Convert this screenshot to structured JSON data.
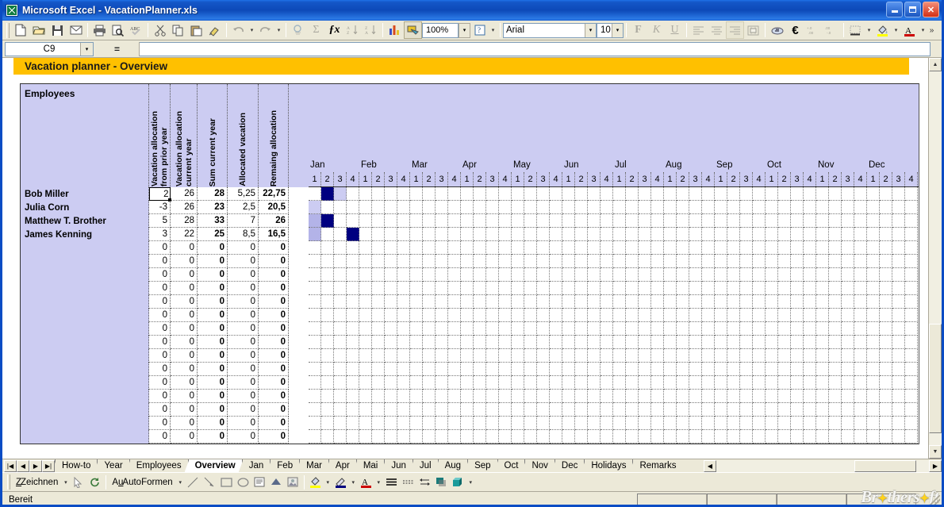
{
  "window": {
    "title": "Microsoft Excel - VacationPlanner.xls",
    "app_icon": "excel-icon",
    "minimize": "–",
    "maximize": "□",
    "close": "✕"
  },
  "toolbar": {
    "zoom_value": "100%",
    "font_name": "Arial",
    "font_size": "10",
    "bold_label": "F",
    "italic_label": "K",
    "underline_label": "U",
    "buttons": [
      "new-icon",
      "open-icon",
      "save-icon",
      "email-icon",
      "print-icon",
      "print-preview-icon",
      "spelling-icon",
      "cut-icon",
      "copy-icon",
      "paste-icon",
      "format-painter-icon",
      "undo-icon",
      "redo-icon",
      "hyperlink-icon",
      "autosum-icon",
      "function-icon",
      "sort-asc-icon",
      "sort-desc-icon",
      "chart-icon",
      "drawing-icon",
      "help-icon"
    ]
  },
  "formula_bar": {
    "name_box": "C9",
    "equals": "=",
    "content": ""
  },
  "banner": {
    "title": "Vacation planner - Overview"
  },
  "table": {
    "employees_header": "Employees",
    "columns": [
      "Vacation allocation\nfrom prior year",
      "Vacation allocation\ncurrent year",
      "Sum current year",
      "Allocated vacation",
      "Remaing allocation"
    ],
    "rows": [
      {
        "name": "Bob Miller",
        "prior": "2",
        "current": "26",
        "sum": "28",
        "allocated": "5,25",
        "remaining": "22,75"
      },
      {
        "name": "Julia Corn",
        "prior": "-3",
        "current": "26",
        "sum": "23",
        "allocated": "2,5",
        "remaining": "20,5"
      },
      {
        "name": "Matthew T. Brother",
        "prior": "5",
        "current": "28",
        "sum": "33",
        "allocated": "7",
        "remaining": "26"
      },
      {
        "name": "James Kenning",
        "prior": "3",
        "current": "22",
        "sum": "25",
        "allocated": "8,5",
        "remaining": "16,5"
      },
      {
        "name": "",
        "prior": "0",
        "current": "0",
        "sum": "0",
        "allocated": "0",
        "remaining": "0"
      },
      {
        "name": "",
        "prior": "0",
        "current": "0",
        "sum": "0",
        "allocated": "0",
        "remaining": "0"
      },
      {
        "name": "",
        "prior": "0",
        "current": "0",
        "sum": "0",
        "allocated": "0",
        "remaining": "0"
      },
      {
        "name": "",
        "prior": "0",
        "current": "0",
        "sum": "0",
        "allocated": "0",
        "remaining": "0"
      },
      {
        "name": "",
        "prior": "0",
        "current": "0",
        "sum": "0",
        "allocated": "0",
        "remaining": "0"
      },
      {
        "name": "",
        "prior": "0",
        "current": "0",
        "sum": "0",
        "allocated": "0",
        "remaining": "0"
      },
      {
        "name": "",
        "prior": "0",
        "current": "0",
        "sum": "0",
        "allocated": "0",
        "remaining": "0"
      },
      {
        "name": "",
        "prior": "0",
        "current": "0",
        "sum": "0",
        "allocated": "0",
        "remaining": "0"
      },
      {
        "name": "",
        "prior": "0",
        "current": "0",
        "sum": "0",
        "allocated": "0",
        "remaining": "0"
      },
      {
        "name": "",
        "prior": "0",
        "current": "0",
        "sum": "0",
        "allocated": "0",
        "remaining": "0"
      },
      {
        "name": "",
        "prior": "0",
        "current": "0",
        "sum": "0",
        "allocated": "0",
        "remaining": "0"
      },
      {
        "name": "",
        "prior": "0",
        "current": "0",
        "sum": "0",
        "allocated": "0",
        "remaining": "0"
      },
      {
        "name": "",
        "prior": "0",
        "current": "0",
        "sum": "0",
        "allocated": "0",
        "remaining": "0"
      },
      {
        "name": "",
        "prior": "0",
        "current": "0",
        "sum": "0",
        "allocated": "0",
        "remaining": "0"
      },
      {
        "name": "",
        "prior": "0",
        "current": "0",
        "sum": "0",
        "allocated": "0",
        "remaining": "0"
      }
    ],
    "selected_cell": {
      "row": 0,
      "column": "prior"
    }
  },
  "calendar": {
    "months": [
      "Jan",
      "Feb",
      "Mar",
      "Apr",
      "May",
      "Jun",
      "Jul",
      "Aug",
      "Sep",
      "Oct",
      "Nov",
      "Dec"
    ],
    "weeks_per_month": [
      "1",
      "2",
      "3",
      "4"
    ],
    "marks": [
      {
        "row": 0,
        "cells": {
          "1": "full",
          "2": "light"
        }
      },
      {
        "row": 1,
        "cells": {
          "0": "light"
        }
      },
      {
        "row": 2,
        "cells": {
          "0": "half",
          "1": "full"
        }
      },
      {
        "row": 3,
        "cells": {
          "0": "half",
          "3": "full"
        }
      }
    ],
    "colors": {
      "full": "#000080",
      "half": "#b3b3e8",
      "light": "#ccccf2",
      "header": "#ccccf2"
    }
  },
  "sheet_tabs": {
    "nav": [
      "first-tab-icon",
      "prev-tab-icon",
      "next-tab-icon",
      "last-tab-icon"
    ],
    "items": [
      "How-to",
      "Year",
      "Employees",
      "Overview",
      "Jan",
      "Feb",
      "Mar",
      "Apr",
      "Mai",
      "Jun",
      "Jul",
      "Aug",
      "Sep",
      "Oct",
      "Nov",
      "Dec",
      "Holidays",
      "Remarks"
    ],
    "active": "Overview"
  },
  "drawing_toolbar": {
    "draw_label": "Zeichnen",
    "autoshapes_label": "AutoFormen",
    "tools": [
      "select-icon",
      "rotate-icon",
      "line-icon",
      "arrow-icon",
      "rectangle-icon",
      "oval-icon",
      "textbox-icon",
      "wordart-icon",
      "clipart-icon",
      "fill-color-icon",
      "line-color-icon",
      "font-color-icon",
      "line-style-icon",
      "dash-style-icon",
      "arrow-style-icon",
      "shadow-icon",
      "3d-icon"
    ]
  },
  "status_bar": {
    "text": "Bereit",
    "watermark": "Brothersoft"
  }
}
